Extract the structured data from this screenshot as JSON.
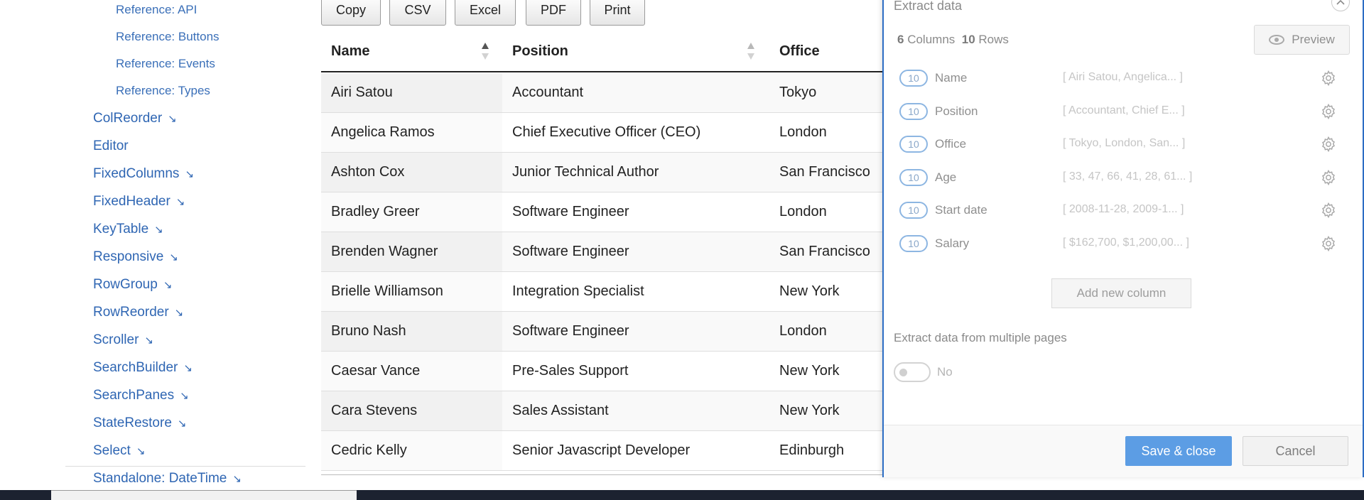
{
  "nav": {
    "sub_items": [
      "Reference: API",
      "Reference: Buttons",
      "Reference: Events",
      "Reference: Types"
    ],
    "items": [
      {
        "label": "ColReorder",
        "external": true
      },
      {
        "label": "Editor",
        "external": false
      },
      {
        "label": "FixedColumns",
        "external": true
      },
      {
        "label": "FixedHeader",
        "external": true
      },
      {
        "label": "KeyTable",
        "external": true
      },
      {
        "label": "Responsive",
        "external": true
      },
      {
        "label": "RowGroup",
        "external": true
      },
      {
        "label": "RowReorder",
        "external": true
      },
      {
        "label": "Scroller",
        "external": true
      },
      {
        "label": "SearchBuilder",
        "external": true
      },
      {
        "label": "SearchPanes",
        "external": true
      },
      {
        "label": "StateRestore",
        "external": true
      },
      {
        "label": "Select",
        "external": true
      },
      {
        "label": "Standalone: DateTime",
        "external": true
      }
    ],
    "arrow_glyph": "↘"
  },
  "toolbar": {
    "buttons": [
      "Copy",
      "CSV",
      "Excel",
      "PDF",
      "Print"
    ]
  },
  "table": {
    "columns": [
      "Name",
      "Position",
      "Office"
    ],
    "sorted_column": "Name",
    "rows": [
      [
        "Airi Satou",
        "Accountant",
        "Tokyo"
      ],
      [
        "Angelica Ramos",
        "Chief Executive Officer (CEO)",
        "London"
      ],
      [
        "Ashton Cox",
        "Junior Technical Author",
        "San Francisco"
      ],
      [
        "Bradley Greer",
        "Software Engineer",
        "London"
      ],
      [
        "Brenden Wagner",
        "Software Engineer",
        "San Francisco"
      ],
      [
        "Brielle Williamson",
        "Integration Specialist",
        "New York"
      ],
      [
        "Bruno Nash",
        "Software Engineer",
        "London"
      ],
      [
        "Caesar Vance",
        "Pre-Sales Support",
        "New York"
      ],
      [
        "Cara Stevens",
        "Sales Assistant",
        "New York"
      ],
      [
        "Cedric Kelly",
        "Senior Javascript Developer",
        "Edinburgh"
      ]
    ]
  },
  "extract": {
    "title": "Extract data",
    "columns_count": "6",
    "columns_word": "Columns",
    "rows_count": "10",
    "rows_word": "Rows",
    "preview_label": "Preview",
    "columns": [
      {
        "count": "10",
        "name": "Name",
        "preview": "[ Airi Satou, Angelica... ]"
      },
      {
        "count": "10",
        "name": "Position",
        "preview": "[ Accountant, Chief E... ]"
      },
      {
        "count": "10",
        "name": "Office",
        "preview": "[ Tokyo, London, San... ]"
      },
      {
        "count": "10",
        "name": "Age",
        "preview": "[ 33, 47, 66, 41, 28, 61... ]"
      },
      {
        "count": "10",
        "name": "Start date",
        "preview": "[ 2008-11-28, 2009-1... ]"
      },
      {
        "count": "10",
        "name": "Salary",
        "preview": "[ $162,700, $1,200,00... ]"
      }
    ],
    "add_column_label": "Add new column",
    "multi_page_label": "Extract data from multiple pages",
    "multi_page_value": "No",
    "save_label": "Save & close",
    "cancel_label": "Cancel"
  },
  "colors": {
    "link": "#2f66b3",
    "panel_border": "#2c6dc4",
    "save": "#5c9de4"
  }
}
